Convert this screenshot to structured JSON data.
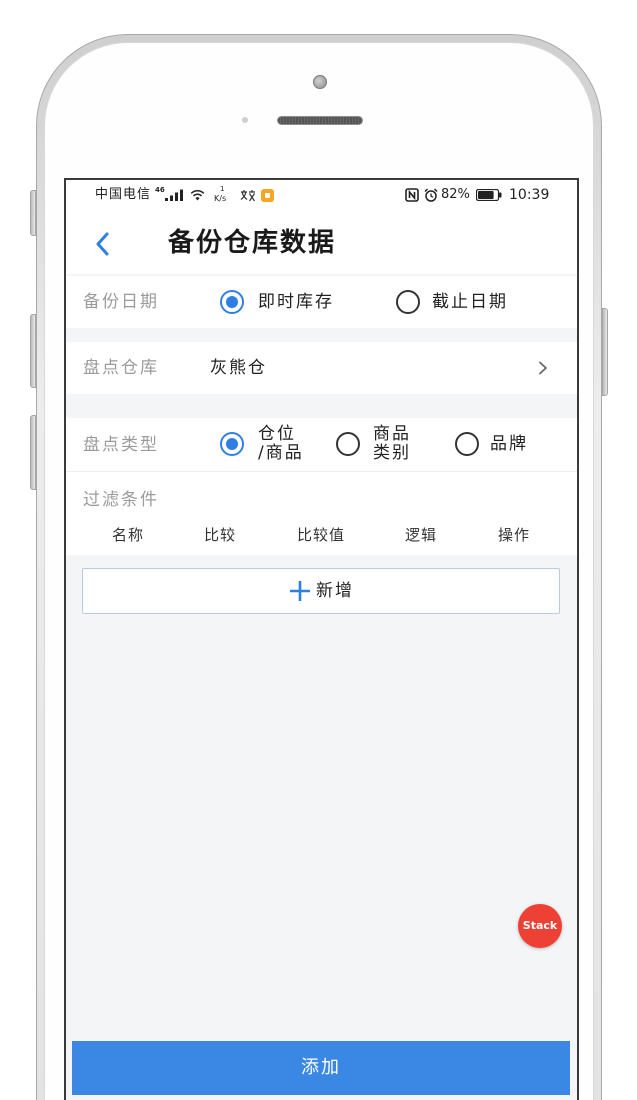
{
  "status_bar": {
    "carrier": "中国电信",
    "network_type": "46",
    "speed_value": "1",
    "speed_unit": "K/s",
    "battery_percent": "82%",
    "battery_level": 82,
    "time": "10:39",
    "icons": [
      "signal-icon",
      "wifi-icon",
      "translate-icon",
      "app-notification-icon",
      "nfc-icon",
      "alarm-icon",
      "battery-icon"
    ]
  },
  "header": {
    "title": "备份仓库数据",
    "back_icon": "chevron-left-icon"
  },
  "form": {
    "backup_date": {
      "label": "备份日期",
      "options": [
        {
          "label": "即时库存",
          "checked": true
        },
        {
          "label": "截止日期",
          "checked": false
        }
      ]
    },
    "warehouse": {
      "label": "盘点仓库",
      "value": "灰熊仓",
      "chevron_icon": "chevron-right-icon"
    },
    "count_type": {
      "label": "盘点类型",
      "options": [
        {
          "lines": [
            "仓位",
            "/商品"
          ],
          "checked": true
        },
        {
          "lines": [
            "商品",
            "类别"
          ],
          "checked": false
        },
        {
          "lines": [
            "品牌"
          ],
          "checked": false
        }
      ]
    },
    "filter": {
      "label": "过滤条件",
      "columns": [
        "名称",
        "比较",
        "比较值",
        "逻辑",
        "操作"
      ]
    },
    "add_button": {
      "label": "新增",
      "icon": "plus-icon"
    }
  },
  "stack_badge": {
    "label": "Stack"
  },
  "submit_button": {
    "label": "添加"
  },
  "colors": {
    "accent": "#2f7fe3",
    "submit_bg": "#3b87e4",
    "stack_bg": "#ee4135",
    "label_gray": "#9b9b9b",
    "page_bg": "#f4f5f7",
    "text_dark": "#222222"
  }
}
